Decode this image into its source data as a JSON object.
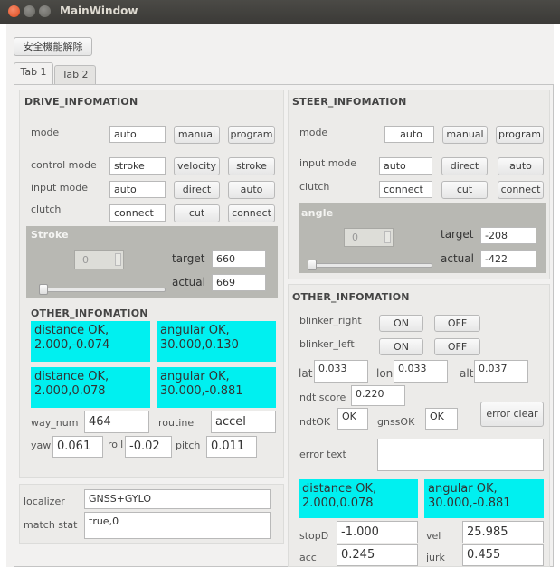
{
  "window": {
    "title": "MainWindow"
  },
  "toolbar": {
    "release_button": "安全機能解除"
  },
  "tabs": [
    {
      "label": "Tab 1"
    },
    {
      "label": "Tab 2"
    }
  ],
  "drive": {
    "header": "DRIVE_INFOMATION",
    "mode_label": "mode",
    "mode_value": "auto",
    "manual_button": "manual",
    "program_button": "program",
    "control_mode_label": "control mode",
    "control_mode_value": "stroke",
    "velocity_button": "velocity",
    "stroke_button": "stroke",
    "input_mode_label": "input mode",
    "input_mode_value": "auto",
    "direct_button": "direct",
    "auto_button": "auto",
    "clutch_label": "clutch",
    "clutch_value": "connect",
    "cut_button": "cut",
    "connect_button": "connect",
    "stroke_label": "Stroke",
    "stroke_spin": "0",
    "target_label": "target",
    "target_value": "660",
    "actual_label": "actual",
    "actual_value": "669",
    "slider_level": 0
  },
  "steer": {
    "header": "STEER_INFOMATION",
    "mode_label": "mode",
    "mode_value": "auto",
    "manual_button": "manual",
    "program_button": "program",
    "input_mode_label": "input mode",
    "input_mode_value": "auto",
    "direct_button": "direct",
    "auto_button": "auto",
    "clutch_label": "clutch",
    "clutch_value": "connect",
    "cut_button": "cut",
    "connect_button": "connect",
    "angle_label": "angle",
    "angle_spin": "0",
    "target_label": "target",
    "target_value": "-208",
    "actual_label": "actual",
    "actual_value": "-422",
    "slider_level": 0
  },
  "other_left": {
    "header": "OTHER_INFOMATION",
    "box1_line1": "distance OK,",
    "box1_line2": "2.000,-0.074",
    "box2_line1": "angular OK,",
    "box2_line2": "30.000,0.130",
    "box3_line1": "distance OK,",
    "box3_line2": "2.000,0.078",
    "box4_line1": "angular OK,",
    "box4_line2": "30.000,-0.881",
    "way_num_label": "way_num",
    "way_num_value": "464",
    "routine_label": "routine",
    "routine_value": "accel",
    "yaw_label": "yaw",
    "yaw_value": "0.061",
    "roll_label": "roll",
    "roll_value": "-0.02",
    "pitch_label": "pitch",
    "pitch_value": "0.011"
  },
  "other_right": {
    "header": "OTHER_INFOMATION",
    "blinker_right_label": "blinker_right",
    "blinker_left_label": "blinker_left",
    "on_button": "ON",
    "off_button": "OFF",
    "lat_label": "lat",
    "lat_value": "0.033",
    "lon_label": "lon",
    "lon_value": "0.033",
    "alt_label": "alt",
    "alt_value": "0.037",
    "ndt_score_label": "ndt score",
    "ndt_score_value": "0.220",
    "ndtok_label": "ndtOK",
    "ndtok_value": "OK",
    "gnssok_label": "gnssOK",
    "gnssok_value": "OK",
    "error_clear_button": "error clear",
    "error_text_label": "error text",
    "error_text_value": "",
    "box1_line1": "distance OK,",
    "box1_line2": "2.000,0.078",
    "box2_line1": "angular OK,",
    "box2_line2": "30.000,-0.881",
    "stopd_label": "stopD",
    "stopd_value": "-1.000",
    "vel_label": "vel",
    "vel_value": "25.985",
    "acc_label": "acc",
    "acc_value": "0.245",
    "jurk_label": "jurk",
    "jurk_value": "0.455"
  },
  "localizer": {
    "localizer_label": "localizer",
    "localizer_value": "GNSS+GYLO",
    "match_stat_label": "match stat",
    "match_stat_value": "true,0"
  },
  "colors": {
    "status_box": "#00f0f0",
    "title_bar": "#3c3b37",
    "gray_panel": "#b8b8b3"
  }
}
